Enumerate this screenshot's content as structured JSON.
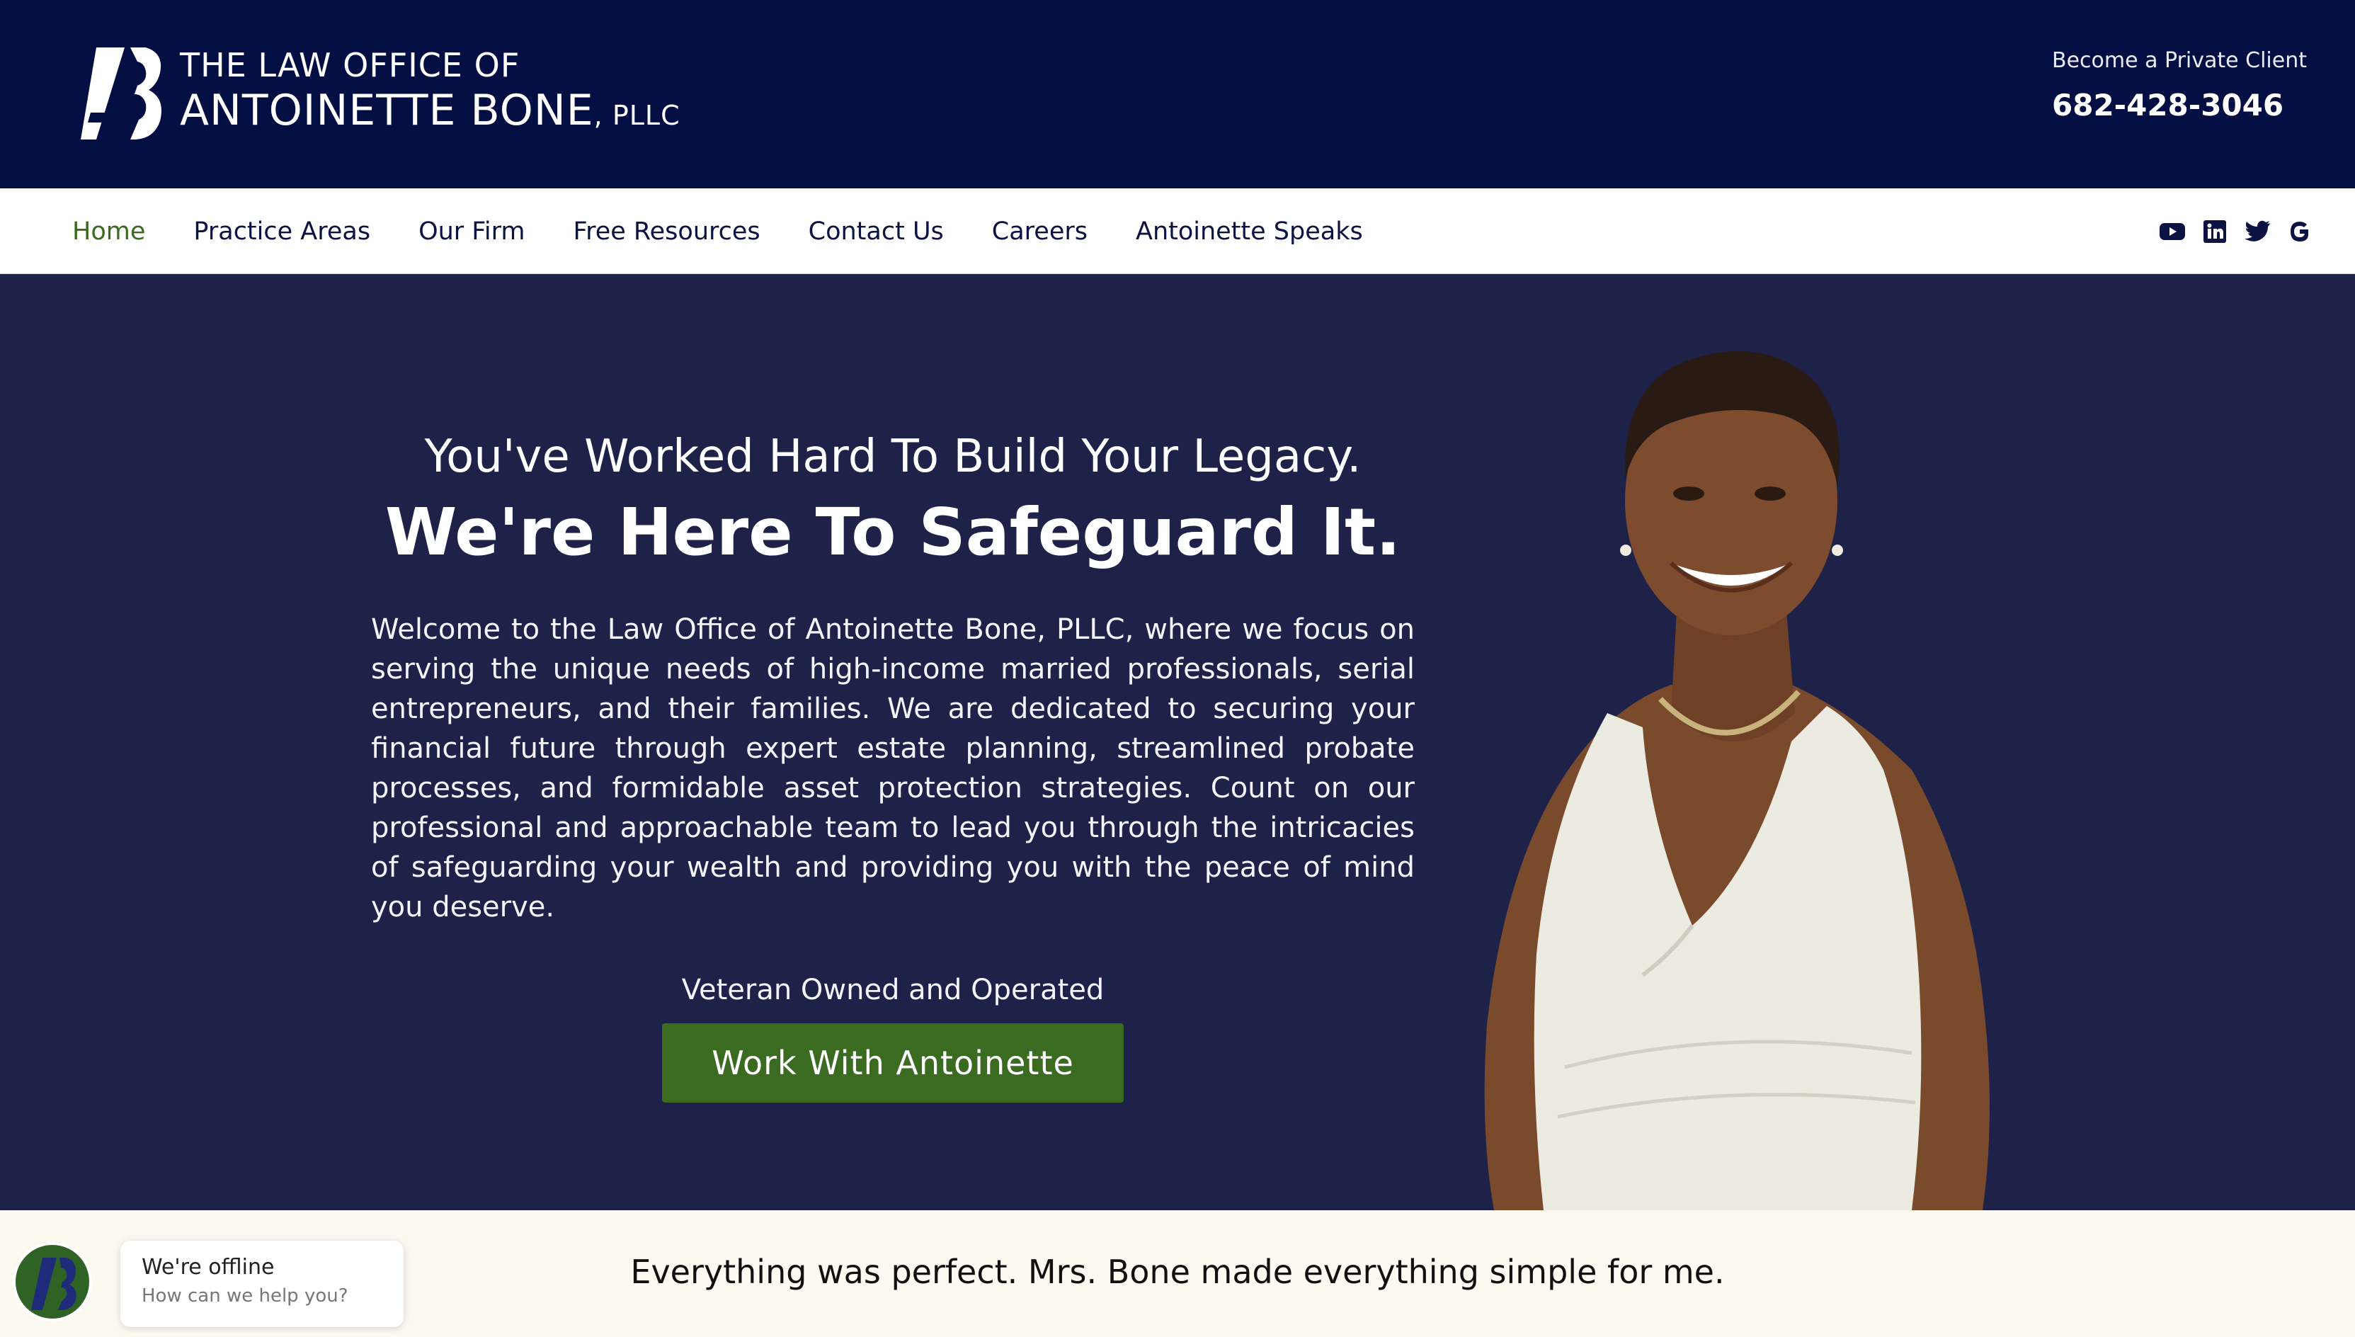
{
  "header": {
    "logo_line1": "THE LAW OFFICE OF",
    "logo_line2": "ANTOINETTE BONE",
    "logo_suffix": ", PLLC",
    "tagline": "Become a Private Client",
    "phone": "682-428-3046"
  },
  "nav": {
    "items": [
      {
        "label": "Home",
        "active": true
      },
      {
        "label": "Practice Areas"
      },
      {
        "label": "Our Firm"
      },
      {
        "label": "Free Resources"
      },
      {
        "label": "Contact Us"
      },
      {
        "label": "Careers"
      },
      {
        "label": "Antoinette Speaks"
      }
    ],
    "social_icons": [
      "youtube-icon",
      "linkedin-icon",
      "twitter-icon",
      "google-icon"
    ]
  },
  "hero": {
    "title_1": "You've Worked Hard To Build Your Legacy.",
    "title_2": "We're Here To Safeguard It.",
    "body": "Welcome to the Law Office of Antoinette Bone, PLLC, where we focus on serving the unique needs of high-income married professionals, serial entrepreneurs, and their families. We are dedicated to securing your financial future through expert estate planning, streamlined probate processes, and formidable asset protection strategies. Count on our professional and approachable team to lead you through the intricacies of safeguarding your wealth and providing you with the peace of mind you deserve.",
    "veteran": "Veteran Owned and Operated",
    "cta": "Work With Antoinette"
  },
  "testimonial": {
    "quote": "Everything was perfect. Mrs. Bone made everything simple for me."
  },
  "chat": {
    "title": "We're offline",
    "subtitle": "How can we help you?"
  },
  "colors": {
    "header_bg": "#030f43",
    "hero_bg": "#1e2249",
    "accent_green": "#3b6a21",
    "nav_text": "#0c1342",
    "band_bg": "#fbf9f0"
  }
}
